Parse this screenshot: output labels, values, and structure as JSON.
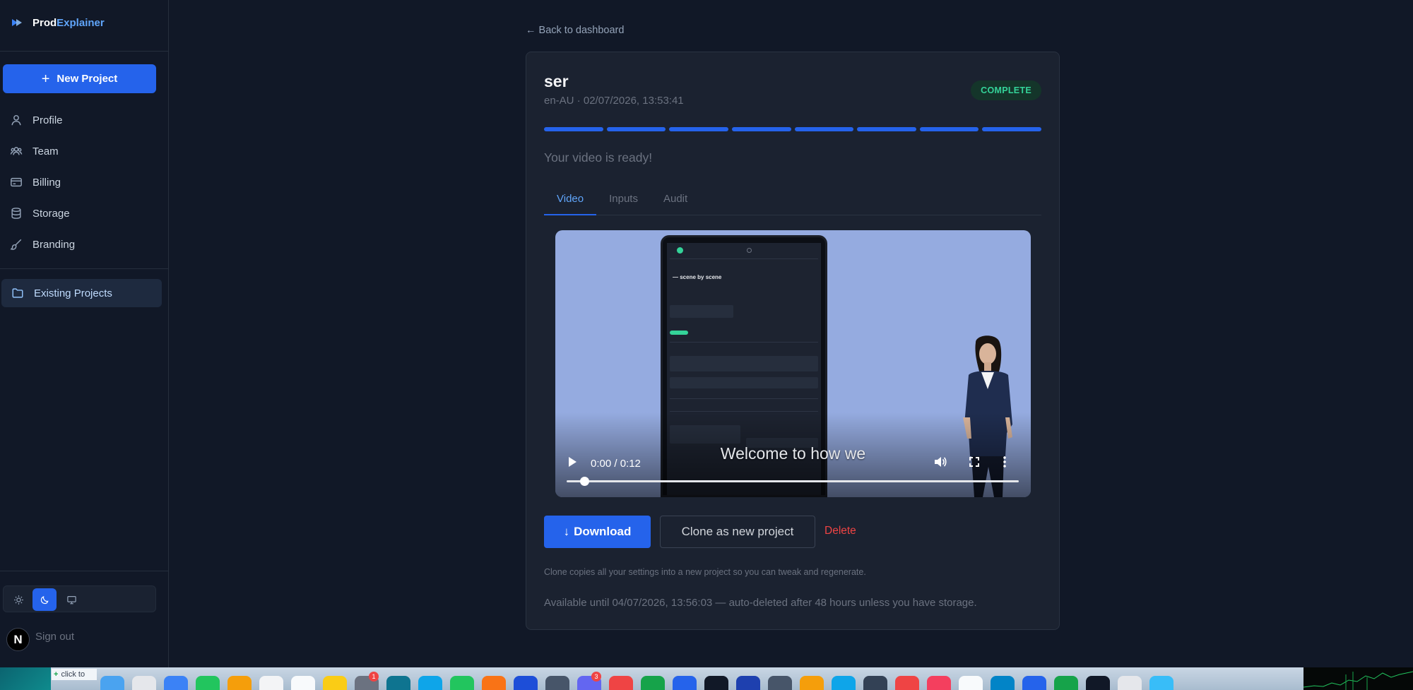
{
  "brand": {
    "part1": "Prod",
    "part2": "Explainer"
  },
  "sidebar": {
    "new_project_label": "New Project",
    "items": [
      {
        "label": "Profile",
        "icon": "user-icon"
      },
      {
        "label": "Team",
        "icon": "users-icon"
      },
      {
        "label": "Billing",
        "icon": "credit-card-icon"
      },
      {
        "label": "Storage",
        "icon": "database-icon"
      },
      {
        "label": "Branding",
        "icon": "brush-icon"
      }
    ],
    "existing_projects_label": "Existing Projects",
    "theme": {
      "selected": "dark",
      "options": [
        "light",
        "dark",
        "system"
      ]
    },
    "avatar_letter": "N",
    "sign_out_label": "Sign out"
  },
  "main": {
    "back_link": "← Back to dashboard",
    "project": {
      "title": "ser",
      "meta": "en-AU · 02/07/2026, 13:53:41",
      "status": "COMPLETE",
      "progress_segments_complete": 8,
      "progress_segments_total": 8,
      "ready_text": "Your video is ready!"
    },
    "tabs": [
      {
        "label": "Video",
        "active": true
      },
      {
        "label": "Inputs",
        "active": false
      },
      {
        "label": "Audit",
        "active": false
      }
    ],
    "video": {
      "time": "0:00 / 0:12",
      "caption": "Welcome to how we",
      "screen_heading": "— scene by scene",
      "progress_fraction": 0.03
    },
    "actions": {
      "download_label": "Download",
      "clone_label": "Clone as new project",
      "delete_label": "Delete"
    },
    "clone_note": "Clone copies all your settings into a new project so you can tweak and regenerate.",
    "availability": "Available until 04/07/2026, 13:56:03 — auto-deleted after 48 hours unless you have storage."
  },
  "dock": {
    "click_label": "click to",
    "badges": [
      "1",
      "3"
    ]
  },
  "colors": {
    "accent": "#2563eb",
    "status_complete": "#34d399",
    "danger": "#ef4444",
    "background": "#111827",
    "card": "#1b2230"
  }
}
